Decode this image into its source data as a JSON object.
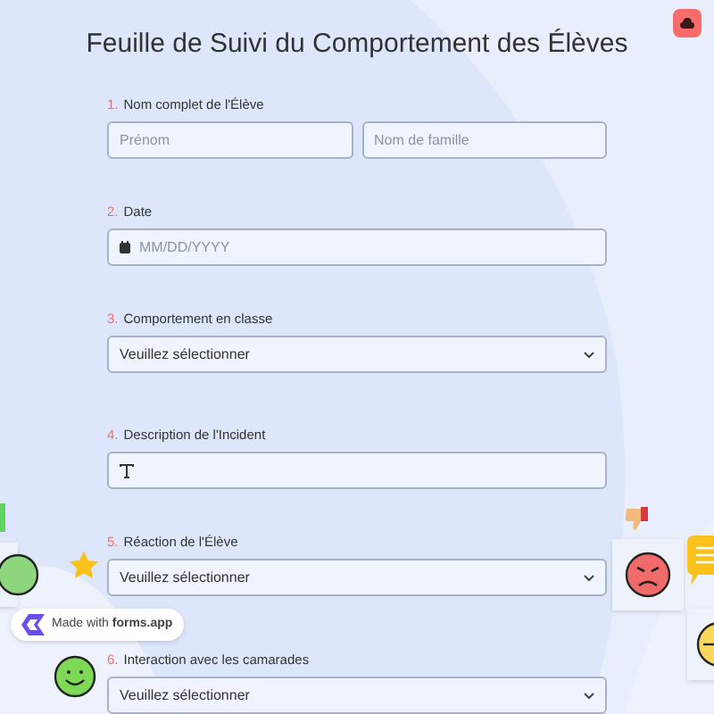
{
  "title": "Feuille de Suivi du Comportement des Élèves",
  "questions": [
    {
      "number": "1.",
      "label": "Nom complet de l'Élève",
      "kind": "name",
      "fields": [
        {
          "placeholder": "Prénom"
        },
        {
          "placeholder": "Nom de famille"
        }
      ]
    },
    {
      "number": "2.",
      "label": "Date",
      "kind": "date",
      "placeholder": "MM/DD/YYYY"
    },
    {
      "number": "3.",
      "label": "Comportement en classe",
      "kind": "select",
      "value": "Veuillez sélectionner"
    },
    {
      "number": "4.",
      "label": "Description de l'Incident",
      "kind": "text"
    },
    {
      "number": "5.",
      "label": "Réaction de l'Élève",
      "kind": "select",
      "value": "Veuillez sélectionner"
    },
    {
      "number": "6.",
      "label": "Interaction avec les camarades",
      "kind": "select",
      "value": "Veuillez sélectionner"
    }
  ],
  "badge": "Made with **forms.app**"
}
